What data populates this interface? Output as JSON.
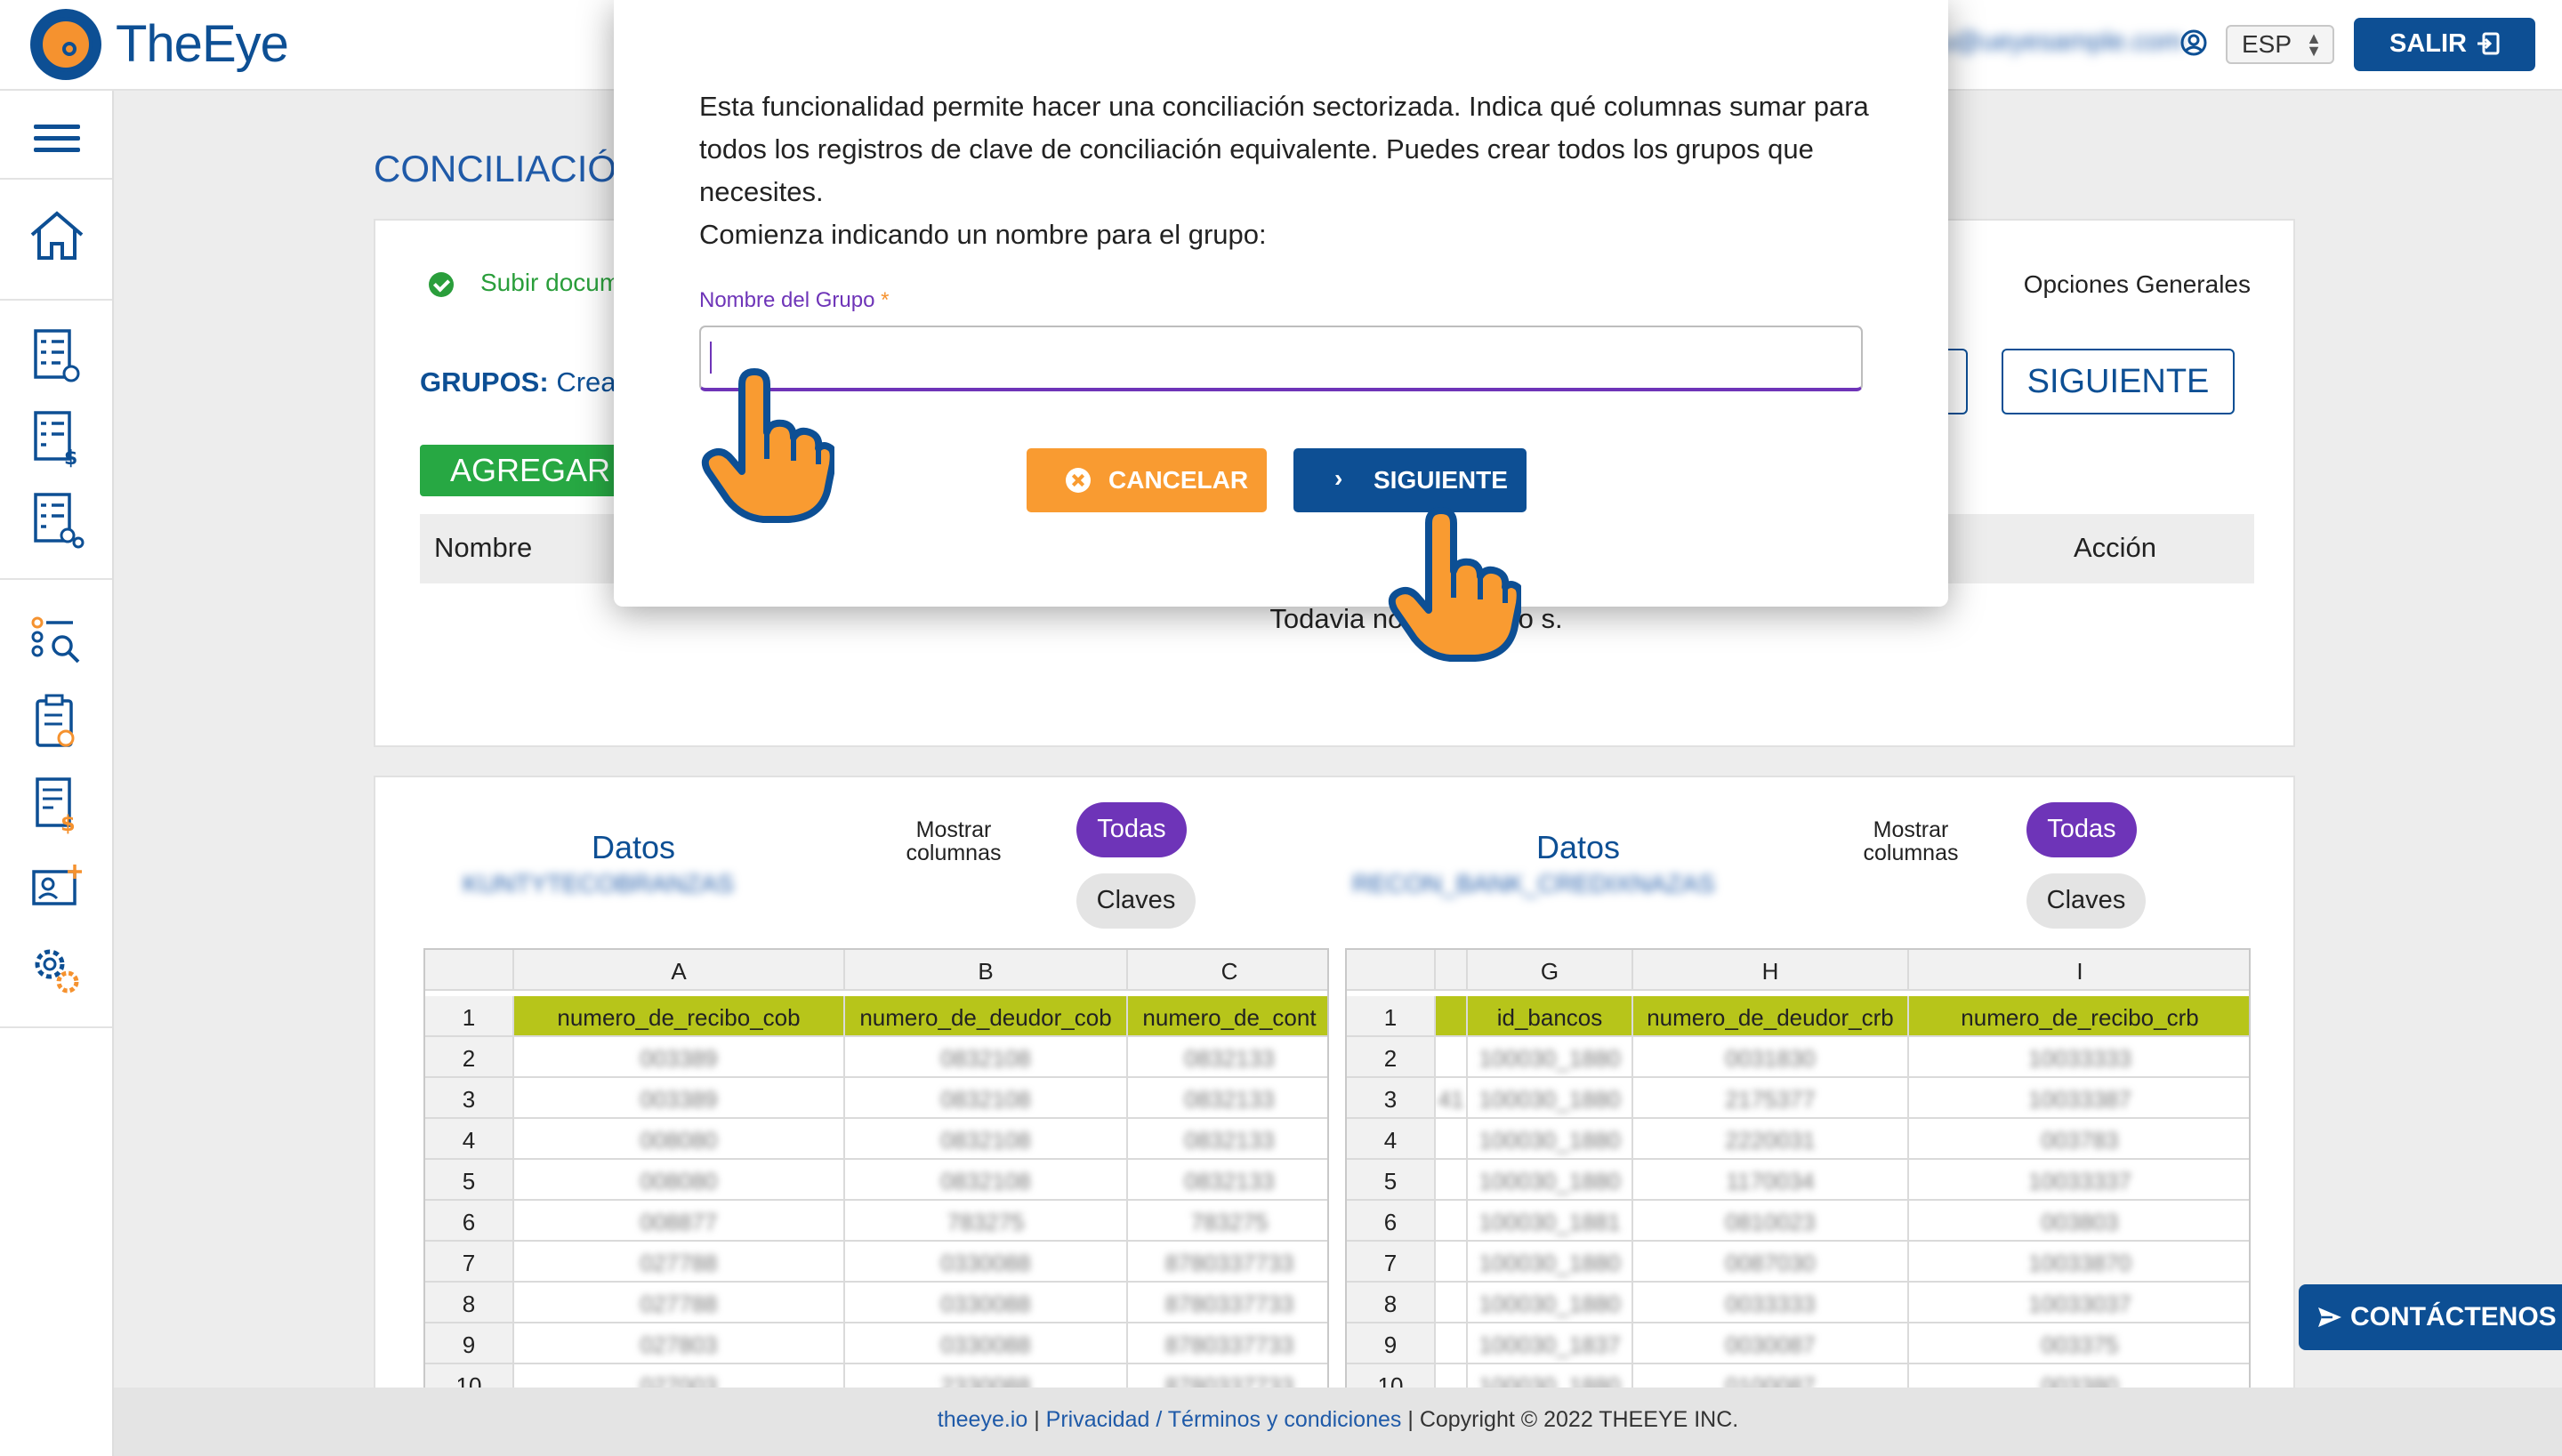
{
  "header": {
    "brand": "TheEye",
    "user_email": "u@ueyesample.com",
    "language": "ESP",
    "logout_label": "SALIR"
  },
  "sidebar": {
    "items": [
      {
        "icon": "home-icon"
      },
      {
        "icon": "checklist-gear-icon"
      },
      {
        "icon": "checklist-dollar-icon"
      },
      {
        "icon": "checklist-settings-icon"
      },
      {
        "icon": "search-list-icon"
      },
      {
        "icon": "clipboard-check-icon"
      },
      {
        "icon": "document-dollar-icon"
      },
      {
        "icon": "user-card-icon"
      },
      {
        "icon": "gears-icon"
      }
    ]
  },
  "main": {
    "page_title": "CONCILIACIÓ",
    "step_label": "Subir docum",
    "general_options": "Opciones Generales",
    "grupos_label": "GRUPOS:",
    "grupos_text": "Crea",
    "next_label": "SIGUIENTE",
    "add_label": "AGREGAR",
    "grid": {
      "col_name": "Nombre",
      "col_action": "Acción",
      "empty_message": "Todavia no hay grupo        s."
    }
  },
  "panels": [
    {
      "title": "Datos",
      "subtitle": "KUNTYTECOBRANZAS",
      "show_columns": "Mostrar columnas",
      "pill_all": "Todas",
      "pill_keys": "Claves",
      "columns": [
        "A",
        "B",
        "C"
      ],
      "header_row": [
        "numero_de_recibo_cob",
        "numero_de_deudor_cob",
        "numero_de_cont"
      ],
      "row_numbers": [
        "1",
        "2",
        "3",
        "4",
        "5",
        "6",
        "7",
        "8",
        "9",
        "10"
      ],
      "rows": [
        [
          "003389",
          "0832108",
          "0832133"
        ],
        [
          "003389",
          "0832108",
          "0832133"
        ],
        [
          "008080",
          "0832108",
          "0832133"
        ],
        [
          "008080",
          "0832108",
          "0832133"
        ],
        [
          "008877",
          "783275",
          "783275"
        ],
        [
          "027788",
          "0330088",
          "8780337733"
        ],
        [
          "027788",
          "0330088",
          "8780337733"
        ],
        [
          "027803",
          "0330088",
          "8780337733"
        ],
        [
          "027003",
          "2330088",
          "8780337733"
        ]
      ]
    },
    {
      "title": "Datos",
      "subtitle": "RECON_BANK_CREDIXNAZAS",
      "show_columns": "Mostrar columnas",
      "pill_all": "Todas",
      "pill_keys": "Claves",
      "columns": [
        "",
        "G",
        "H",
        "I"
      ],
      "header_row": [
        "",
        "id_bancos",
        "numero_de_deudor_crb",
        "numero_de_recibo_crb"
      ],
      "row_numbers": [
        "1",
        "2",
        "3",
        "4",
        "5",
        "6",
        "7",
        "8",
        "9",
        "10"
      ],
      "rows": [
        [
          "",
          "100030_1880",
          "0031830",
          "10033333"
        ],
        [
          "41",
          "100030_1880",
          "2175377",
          "10033387"
        ],
        [
          "",
          "100030_1880",
          "2220031",
          "003783"
        ],
        [
          "",
          "100030_1880",
          "1170034",
          "10033337"
        ],
        [
          "",
          "100030_1881",
          "0810023",
          "003803"
        ],
        [
          "",
          "100030_1880",
          "0087030",
          "10033870"
        ],
        [
          "",
          "100030_1880",
          "0033333",
          "10033037"
        ],
        [
          "",
          "100030_1837",
          "0030087",
          "003375"
        ],
        [
          "",
          "100030_1880",
          "0100087",
          "003380"
        ]
      ]
    }
  ],
  "footer": {
    "site": "theeye.io",
    "sep1": "|",
    "privacy": "Privacidad / Términos y condiciones",
    "sep2": "|",
    "copyright": "Copyright © 2022 THEEYE INC."
  },
  "contact_label": "CONTÁCTENOS",
  "modal": {
    "description": "Esta funcionalidad permite hacer una conciliación sectorizada. Indica qué columnas sumar para todos los registros de clave de conciliación equivalente. Puedes crear todos los grupos que necesites.",
    "prompt": "Comienza indicando un nombre para el grupo:",
    "field_label": "Nombre del Grupo",
    "field_required": "*",
    "field_value": "",
    "cancel_label": "CANCELAR",
    "next_label": "SIGUIENTE"
  },
  "colors": {
    "brand_blue": "#0d4f94",
    "accent_orange": "#f99b31",
    "accent_purple": "#6e34b8",
    "success_green": "#27a843",
    "key_highlight": "#b7c51a"
  }
}
